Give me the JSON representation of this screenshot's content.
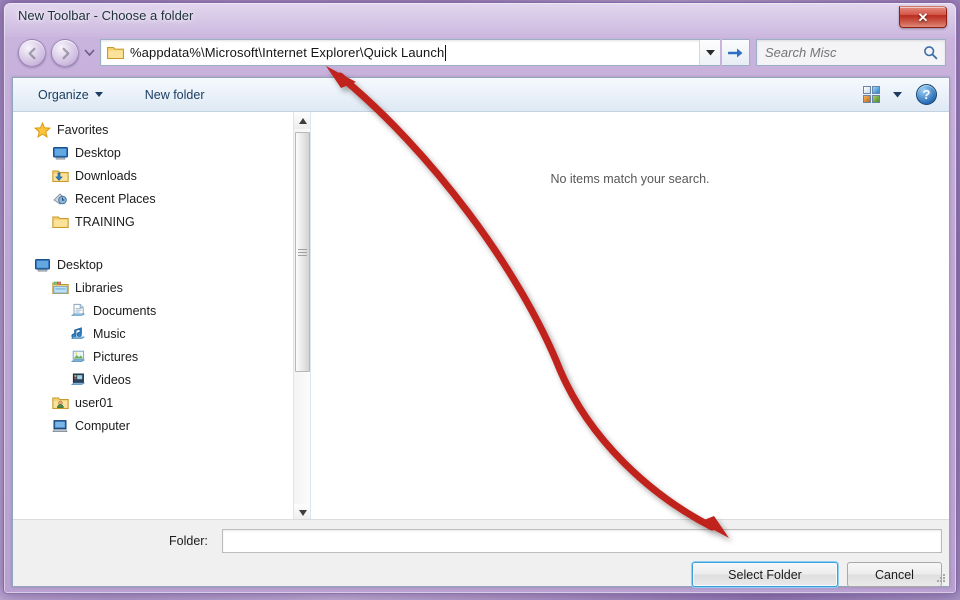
{
  "window": {
    "title": "New Toolbar - Choose a folder",
    "close_label": "✕"
  },
  "navigation": {
    "back_icon": "back-arrow-icon",
    "forward_icon": "forward-arrow-icon",
    "history_icon": "chevron-down-icon",
    "address_path": "%appdata%\\Microsoft\\Internet Explorer\\Quick Launch",
    "address_dropdown_icon": "chevron-down-icon",
    "go_icon": "go-arrow-icon"
  },
  "search": {
    "placeholder": "Search Misc",
    "value": "",
    "icon": "search-icon"
  },
  "toolbar": {
    "organize_label": "Organize",
    "organize_caret_icon": "caret-down-icon",
    "new_folder_label": "New folder",
    "view_icon": "view-mode-icon",
    "view_caret_icon": "caret-down-icon",
    "help_label": "?"
  },
  "nav_pane": {
    "groups": [
      {
        "items": [
          {
            "label": "Favorites",
            "icon": "star-icon",
            "level": 0
          },
          {
            "label": "Desktop",
            "icon": "desktop-icon",
            "level": 1
          },
          {
            "label": "Downloads",
            "icon": "downloads-folder-icon",
            "level": 1
          },
          {
            "label": "Recent Places",
            "icon": "recent-places-icon",
            "level": 1
          },
          {
            "label": "TRAINING",
            "icon": "folder-icon",
            "level": 1
          }
        ]
      },
      {
        "items": [
          {
            "label": "Desktop",
            "icon": "desktop-icon",
            "level": 0
          },
          {
            "label": "Libraries",
            "icon": "libraries-icon",
            "level": 1
          },
          {
            "label": "Documents",
            "icon": "documents-library-icon",
            "level": 2
          },
          {
            "label": "Music",
            "icon": "music-library-icon",
            "level": 2
          },
          {
            "label": "Pictures",
            "icon": "pictures-library-icon",
            "level": 2
          },
          {
            "label": "Videos",
            "icon": "videos-library-icon",
            "level": 2
          },
          {
            "label": "user01",
            "icon": "user-folder-icon",
            "level": 1
          },
          {
            "label": "Computer",
            "icon": "computer-icon",
            "level": 1
          }
        ]
      }
    ],
    "scrollbar": {
      "up_icon": "scroll-up-arrow-icon",
      "down_icon": "scroll-down-arrow-icon"
    }
  },
  "file_list": {
    "empty_message": "No items match your search."
  },
  "footer": {
    "folder_label": "Folder:",
    "folder_value": "",
    "folder_placeholder": "",
    "select_folder_label": "Select Folder",
    "cancel_label": "Cancel",
    "resize_grip_icon": "resize-grip-icon"
  },
  "annotation": {
    "arrow_color": "#c0201c",
    "description": "red double-headed curved arrow from address bar to Select Folder button"
  },
  "colors": {
    "accent": "#3c9ddb",
    "close_red": "#b92c1d",
    "frame_purple": "#b9a1d2",
    "annotation_red": "#c0201c"
  }
}
